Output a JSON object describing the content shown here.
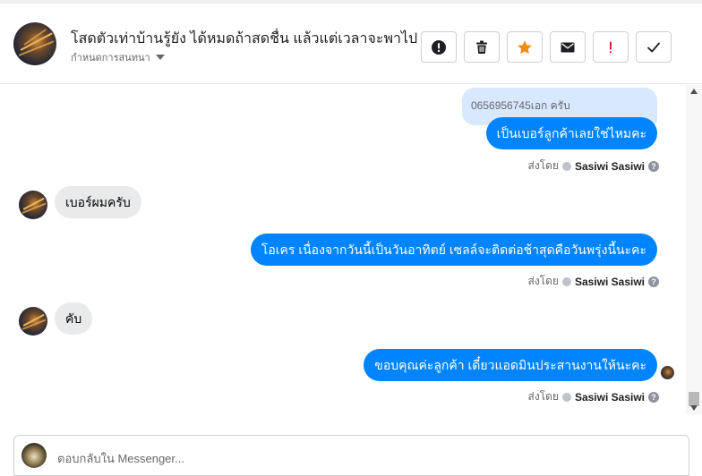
{
  "header": {
    "title": "โสดตัวเท่าบ้านรู้ยัง ได้หมดถ้าสดชื่น แล้วแต่เวลาจะพาไป",
    "subtitle": "กำหนดการสนทนา",
    "actions": [
      {
        "name": "mark-spam-button",
        "icon": "exclamation-circle-icon"
      },
      {
        "name": "delete-button",
        "icon": "trash-icon"
      },
      {
        "name": "star-button",
        "icon": "star-icon"
      },
      {
        "name": "mark-unread-button",
        "icon": "envelope-icon"
      },
      {
        "name": "follow-up-button",
        "icon": "exclamation-icon"
      },
      {
        "name": "mark-done-button",
        "icon": "check-icon"
      }
    ]
  },
  "messages": {
    "quote_text": "0656956745เอก ครับ",
    "out_1": "เป็นเบอร์ลูกค้าเลยใช่ไหมคะ",
    "in_1": "เบอร์ผมครับ",
    "out_2": "โอเคร เนื่องจากวันนี้เป็นวันอาทิตย์ เซลล์จะติดต่อช้าสุดคือวันพรุ่งนี้นะคะ",
    "in_2": "คับ",
    "out_3": "ขอบคุณค่ะลูกค้า เดี๋ยวแอดมินประสานงานให้นะคะ",
    "sent_by_label": "ส่งโดย",
    "sender_name": "Sasiwi Sasiwi",
    "help_glyph": "?"
  },
  "composer": {
    "placeholder": "ตอบกลับใน Messenger..."
  },
  "colors": {
    "accent": "#0084ff",
    "star": "#f28b1c",
    "follow_up": "#e41e3f"
  }
}
